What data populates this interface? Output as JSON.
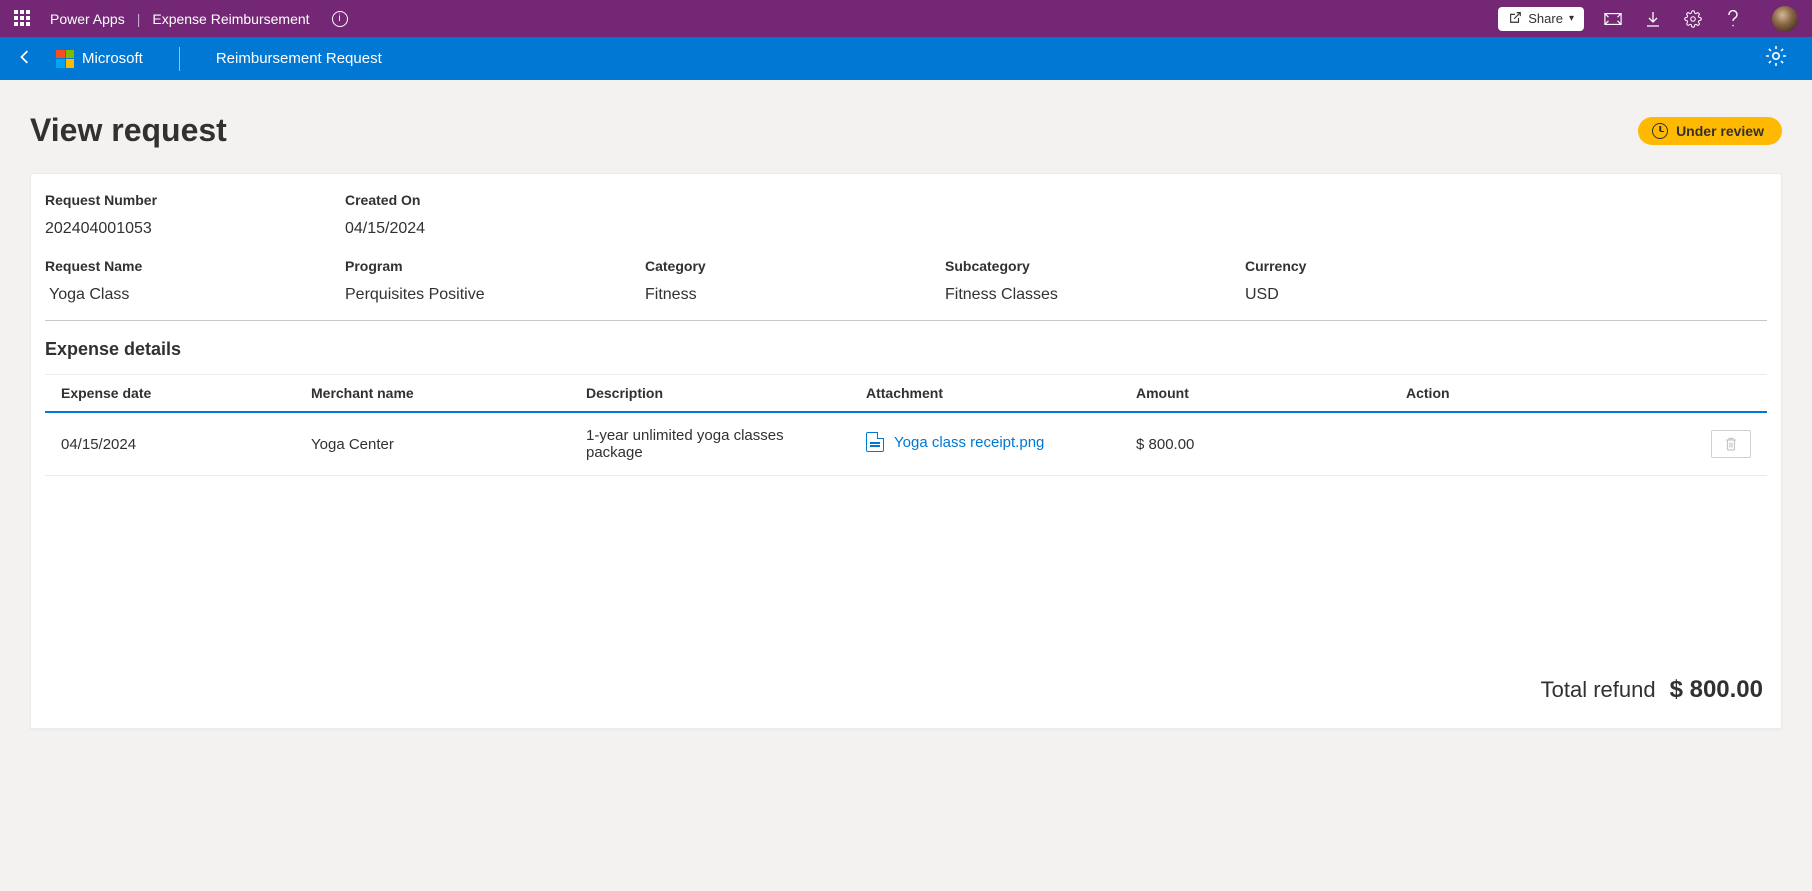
{
  "topbar": {
    "brand": "Power Apps",
    "app": "Expense Reimbursement",
    "share_label": "Share"
  },
  "appheader": {
    "ms_label": "Microsoft",
    "screen": "Reimbursement Request"
  },
  "page": {
    "title": "View request",
    "status_label": "Under review"
  },
  "request": {
    "number_label": "Request Number",
    "number": "202404001053",
    "created_label": "Created On",
    "created": "04/15/2024",
    "name_label": "Request Name",
    "name": "Yoga Class",
    "program_label": "Program",
    "program": "Perquisites Positive",
    "category_label": "Category",
    "category": "Fitness",
    "subcategory_label": "Subcategory",
    "subcategory": "Fitness Classes",
    "currency_label": "Currency",
    "currency": "USD"
  },
  "expense": {
    "section_title": "Expense details",
    "columns": {
      "date": "Expense date",
      "merchant": "Merchant name",
      "description": "Description",
      "attachment": "Attachment",
      "amount": "Amount",
      "action": "Action"
    },
    "rows": [
      {
        "date": "04/15/2024",
        "merchant": "Yoga Center",
        "description": "1-year unlimited yoga classes package",
        "attachment": "Yoga class receipt.png",
        "amount": "$ 800.00"
      }
    ],
    "total_label": "Total refund",
    "total_value": "$ 800.00"
  }
}
